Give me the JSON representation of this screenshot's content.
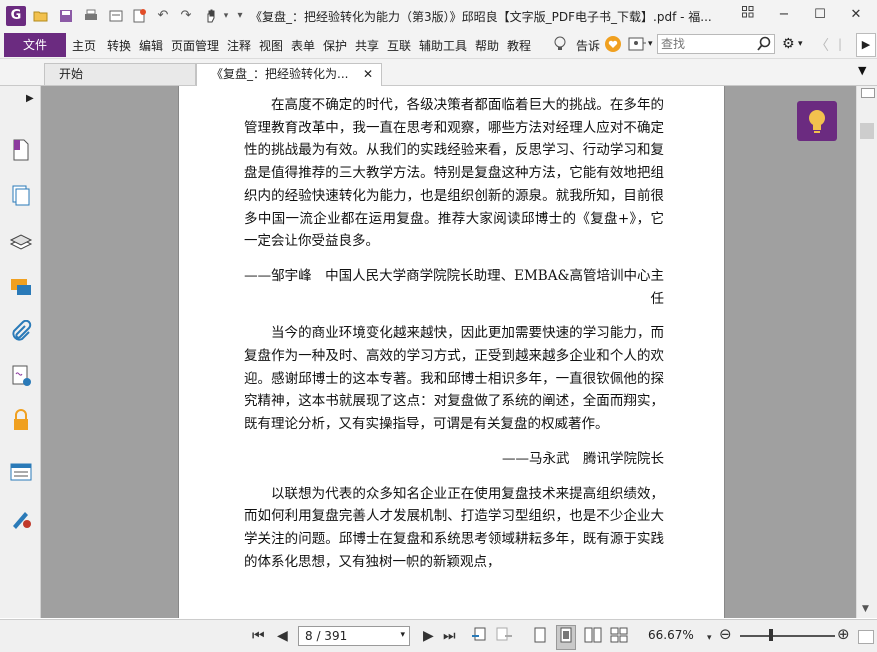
{
  "titlebar": {
    "app_icon": "G",
    "title": "《复盘_：把经验转化为能力（第3版）》邱昭良【文字版_PDF电子书_下载】.pdf - 福..."
  },
  "menubar": {
    "file": "文件",
    "items": [
      "主页",
      "转换",
      "编辑",
      "页面管理",
      "注释",
      "视图",
      "表单",
      "保护",
      "共享",
      "互联",
      "辅助工具",
      "帮助",
      "教程"
    ],
    "tell_me": "告诉",
    "search_placeholder": "查找"
  },
  "tabs": [
    {
      "label": "开始"
    },
    {
      "label": "《复盘_：把经验转化为..."
    }
  ],
  "document": {
    "paragraphs": [
      {
        "type": "para",
        "text": "在高度不确定的时代，各级决策者都面临着巨大的挑战。在多年的管理教育改革中，我一直在思考和观察，哪些方法对经理人应对不确定性的挑战最为有效。从我们的实践经验来看，反思学习、行动学习和复盘是值得推荐的三大教学方法。特别是复盘这种方法，它能有效地把组织内的经验快速转化为能力，也是组织创新的源泉。就我所知，目前很多中国一流企业都在运用复盘。推荐大家阅读邱博士的《复盘+》，它一定会让你受益良多。"
      },
      {
        "type": "sig",
        "text": "——邹宇峰　中国人民大学商学院院长助理、EMBA&高管培训中心主任"
      },
      {
        "type": "para",
        "text": "当今的商业环境变化越来越快，因此更加需要快速的学习能力，而复盘作为一种及时、高效的学习方式，正受到越来越多企业和个人的欢迎。感谢邱博士的这本专著。我和邱博士相识多年，一直很钦佩他的探究精神，这本书就展现了这点：对复盘做了系统的阐述，全面而翔实，既有理论分析，又有实操指导，可谓是有关复盘的权威著作。"
      },
      {
        "type": "sig",
        "text": "——马永武　腾讯学院院长"
      },
      {
        "type": "para",
        "text": "以联想为代表的众多知名企业正在使用复盘技术来提高组织绩效，而如何利用复盘完善人才发展机制、打造学习型组织，也是不少企业大学关注的问题。邱博士在复盘和系统思考领域耕耘多年，既有源于实践的体系化思想，又有独树一帜的新颖观点，"
      }
    ]
  },
  "statusbar": {
    "page_indicator": "8 / 391",
    "zoom": "66.67%"
  },
  "colors": {
    "accent": "#6b2b80",
    "canvas": "#a0a0a0",
    "chrome": "#f3f3f3"
  }
}
